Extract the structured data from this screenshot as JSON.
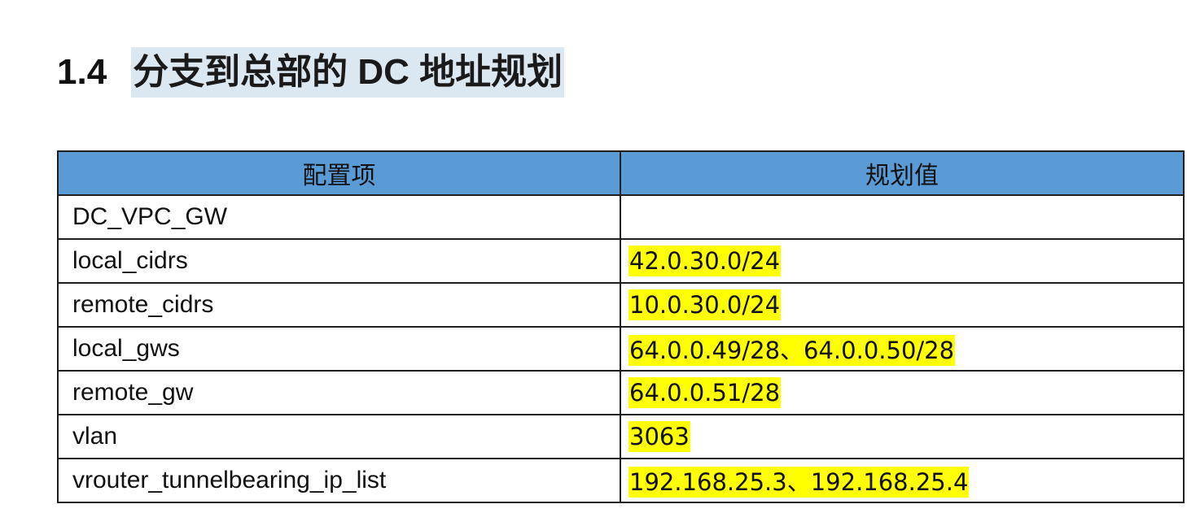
{
  "heading": {
    "number": "1.4",
    "title": "分支到总部的 DC 地址规划"
  },
  "table": {
    "headers": [
      "配置项",
      "规划值"
    ],
    "rows": [
      {
        "key": "DC_VPC_GW",
        "value": ""
      },
      {
        "key": "local_cidrs",
        "value": "42.0.30.0/24"
      },
      {
        "key": "remote_cidrs",
        "value": "10.0.30.0/24"
      },
      {
        "key": "local_gws",
        "value": "64.0.0.49/28、64.0.0.50/28"
      },
      {
        "key": "remote_gw",
        "value": "64.0.0.51/28"
      },
      {
        "key": "vlan",
        "value": "3063"
      },
      {
        "key": "vrouter_tunnelbearing_ip_list",
        "value": "192.168.25.3、192.168.25.4"
      }
    ]
  },
  "colors": {
    "header_bg": "#5b9bd5",
    "highlight": "#ffff00",
    "title_highlight": "#dbe7f1"
  }
}
